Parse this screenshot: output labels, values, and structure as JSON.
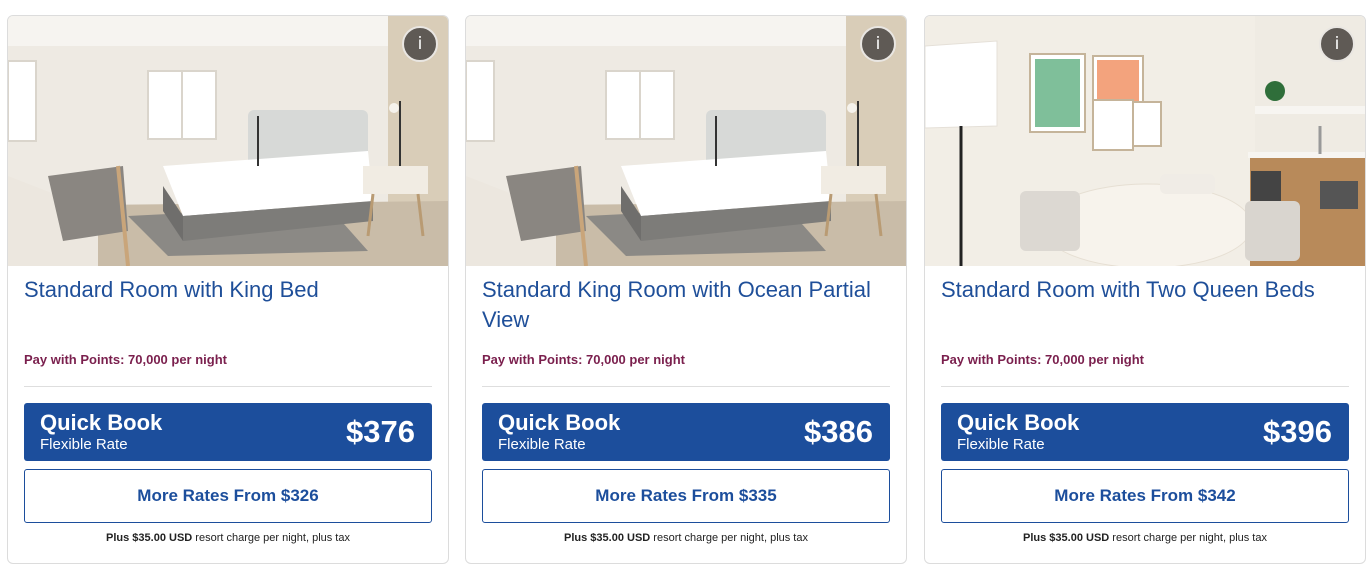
{
  "rooms": [
    {
      "title": "Standard Room with King Bed",
      "points": "Pay with Points: 70,000 per night",
      "quick_book": {
        "label": "Quick Book",
        "sublabel": "Flexible Rate",
        "price": "$376"
      },
      "more_rates": "More Rates From $326",
      "resort": {
        "amount": "Plus $35.00 USD",
        "text": " resort charge per night, plus tax"
      },
      "info_label": "i",
      "image": "hotel-room-king-bed-photo"
    },
    {
      "title": "Standard King Room with Ocean Partial View",
      "points": "Pay with Points: 70,000 per night",
      "quick_book": {
        "label": "Quick Book",
        "sublabel": "Flexible Rate",
        "price": "$386"
      },
      "more_rates": "More Rates From $335",
      "resort": {
        "amount": "Plus $35.00 USD",
        "text": " resort charge per night, plus tax"
      },
      "info_label": "i",
      "image": "hotel-room-king-ocean-view-photo"
    },
    {
      "title": "Standard Room with Two Queen Beds",
      "points": "Pay with Points: 70,000 per night",
      "quick_book": {
        "label": "Quick Book",
        "sublabel": "Flexible Rate",
        "price": "$396"
      },
      "more_rates": "More Rates From $342",
      "resort": {
        "amount": "Plus $35.00 USD",
        "text": " resort charge per night, plus tax"
      },
      "info_label": "i",
      "image": "hotel-room-dining-kitchenette-photo"
    }
  ],
  "colors": {
    "title_blue": "#1f4f99",
    "button_blue": "#1c4e9c",
    "points_maroon": "#7a1f4d"
  }
}
